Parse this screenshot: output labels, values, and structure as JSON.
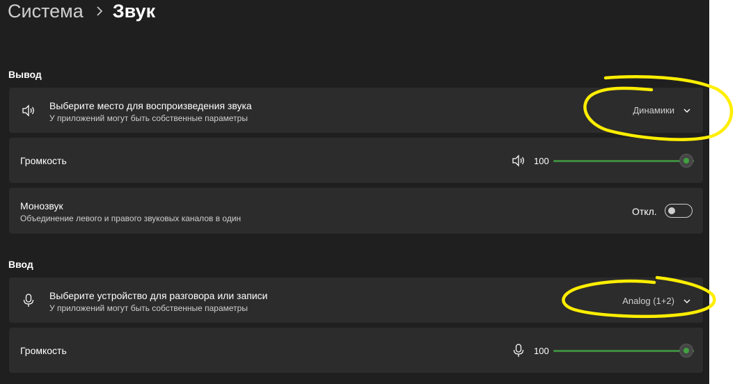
{
  "breadcrumb": {
    "parent": "Система",
    "current": "Звук"
  },
  "output": {
    "section_title": "Вывод",
    "device": {
      "title": "Выберите место для воспроизведения звука",
      "subtitle": "У приложений могут быть собственные параметры",
      "selected": "Динамики"
    },
    "volume": {
      "label": "Громкость",
      "value": "100",
      "level": 100
    },
    "mono": {
      "title": "Монозвук",
      "subtitle": "Объединение левого и правого звуковых каналов в один",
      "state_label": "Откл."
    }
  },
  "input": {
    "section_title": "Ввод",
    "device": {
      "title": "Выберите устройство для разговора или записи",
      "subtitle": "У приложений могут быть собственные параметры",
      "selected": "Analog (1+2)"
    },
    "volume": {
      "label": "Громкость",
      "value": "100",
      "level": 100
    }
  },
  "colors": {
    "accent": "#3fa13f",
    "annotation": "#ffee00",
    "background": "#1f1f1f",
    "card": "#2c2c2c"
  }
}
